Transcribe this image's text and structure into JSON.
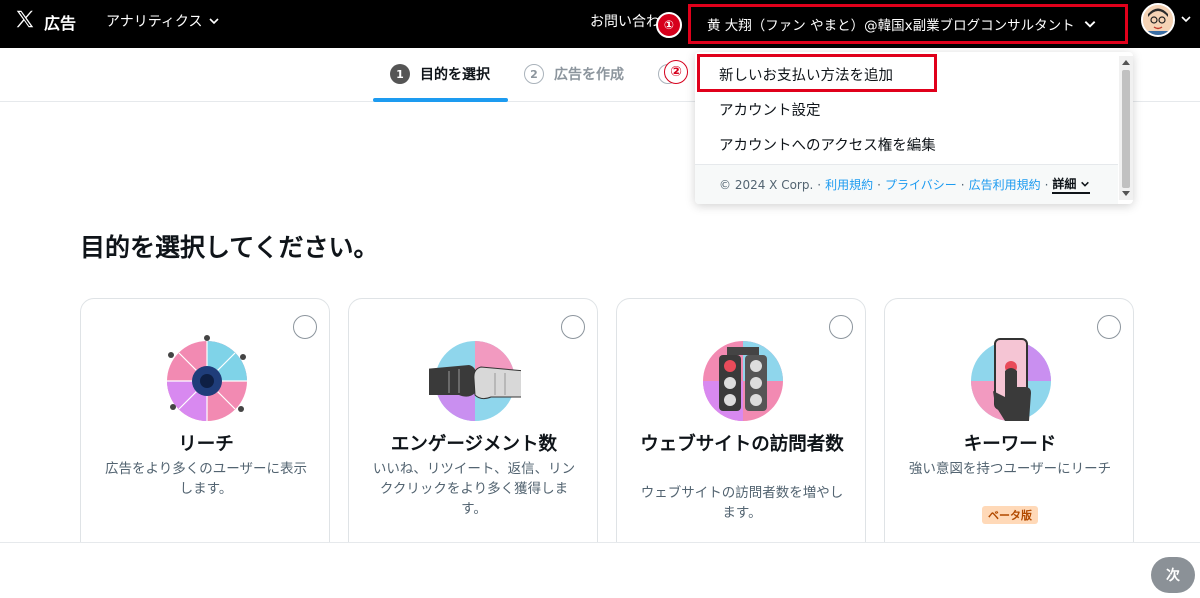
{
  "topbar": {
    "brand": "広告",
    "analytics_label": "アナリティクス",
    "contact_label": "お問い合わせ",
    "annotation_1": "①",
    "account_name": "黄 大翔（ファン やまと）@韓国x副業ブログコンサルタント"
  },
  "steps": [
    {
      "num": "1",
      "label": "目的を選択"
    },
    {
      "num": "2",
      "label": "広告を作成"
    },
    {
      "num": "3"
    }
  ],
  "dropdown": {
    "annotation_2": "②",
    "items": [
      "新しいお支払い方法を追加",
      "アカウント設定",
      "アカウントへのアクセス権を編集"
    ],
    "footer": {
      "copyright": "© 2024 X Corp.",
      "sep": "·",
      "links": [
        "利用規約",
        "プライバシー",
        "広告利用規約"
      ],
      "more": "詳細"
    }
  },
  "page": {
    "title": "目的を選択してください。",
    "cards": [
      {
        "title": "リーチ",
        "desc": "広告をより多くのユーザーに表示します。"
      },
      {
        "title": "エンゲージメント数",
        "desc": "いいね、リツイート、返信、リンククリックをより多く獲得します。"
      },
      {
        "title": "ウェブサイトの訪問者数",
        "desc": "ウェブサイトの訪問者数を増やします。"
      },
      {
        "title": "キーワード",
        "desc": "強い意図を持つユーザーにリーチ",
        "badge": "ベータ版"
      }
    ]
  },
  "footer": {
    "next_label": "次"
  },
  "colors": {
    "accent": "#1d9bf0",
    "annotation_red": "#e0001b",
    "topbar": "#000000"
  }
}
